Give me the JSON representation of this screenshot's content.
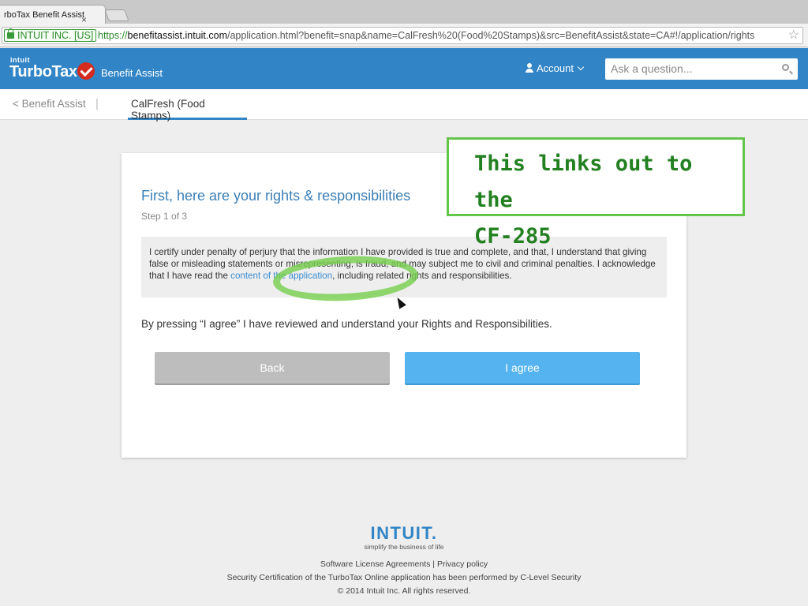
{
  "browser": {
    "tab_title": "rboTax Benefit Assist",
    "tab_close": "×",
    "ev_label": "INTUIT INC. [US]",
    "url_scheme": "https://",
    "url_domain": "benefitassist.intuit.com",
    "url_path": "/application.html?benefit=snap&name=CalFresh%20(Food%20Stamps)&src=BenefitAssist&state=CA#!/application/rights",
    "bookmark_icon": "☆"
  },
  "header": {
    "brand_small": "intuit",
    "brand": "TurboTax",
    "product": "Benefit Assist",
    "account_label": "Account",
    "search_placeholder": "Ask a question..."
  },
  "subnav": {
    "back_label": "< Benefit Assist",
    "separator": "|",
    "active_tab": "CalFresh (Food Stamps)"
  },
  "card": {
    "title": "First, here are your rights & responsibilities",
    "step": "Step 1 of 3",
    "rights_text_before": "I certify under penalty of perjury that the information I have provided is true and complete, and that, I understand that giving false or misleading statements or misrepresenting, is fraud, and may subject me to civil and criminal penalties. I acknowledge that I have read the ",
    "rights_link": "content of the application",
    "rights_text_after": ", including related rights and responsibilities.",
    "press_text": "By pressing “I agree” I have reviewed and understand your Rights and Responsibilities.",
    "back_button": "Back",
    "agree_button": "I agree"
  },
  "annotation": {
    "line1": "This links out to the",
    "line2": "CF-285"
  },
  "footer": {
    "logo": "INTUIT.",
    "tagline": "simplify the business of life",
    "link_license": "Software License Agreements",
    "link_sep": " | ",
    "link_privacy": "Privacy policy",
    "security": "Security Certification of the TurboTax Online application has been performed by C-Level Security",
    "copyright": "© 2014 Intuit Inc. All rights reserved."
  },
  "colors": {
    "header_blue": "#3185c6",
    "agree_button": "#55b4ef",
    "back_button": "#bdbdbd",
    "annotation_green": "#63c54a",
    "annotation_text": "#238020"
  }
}
